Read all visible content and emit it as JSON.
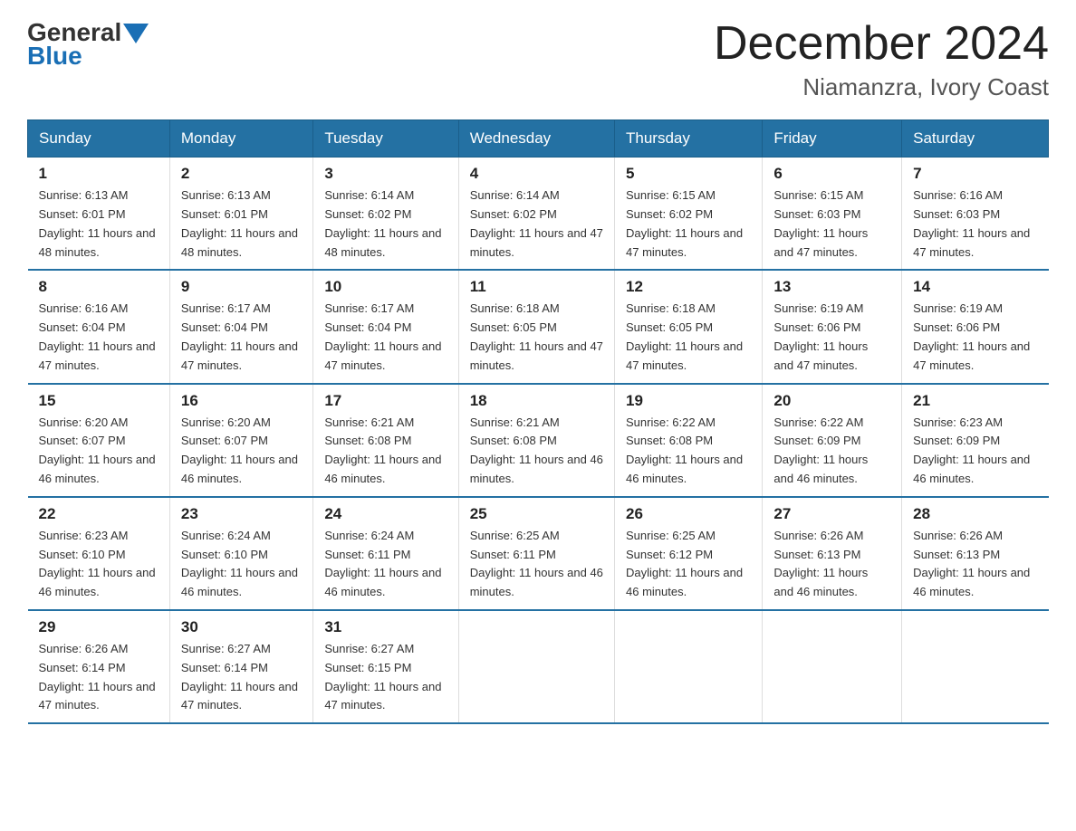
{
  "logo": {
    "text_general": "General",
    "text_blue": "Blue"
  },
  "title": "December 2024",
  "subtitle": "Niamanzra, Ivory Coast",
  "headers": [
    "Sunday",
    "Monday",
    "Tuesday",
    "Wednesday",
    "Thursday",
    "Friday",
    "Saturday"
  ],
  "weeks": [
    [
      {
        "day": "1",
        "sunrise": "6:13 AM",
        "sunset": "6:01 PM",
        "daylight": "11 hours and 48 minutes."
      },
      {
        "day": "2",
        "sunrise": "6:13 AM",
        "sunset": "6:01 PM",
        "daylight": "11 hours and 48 minutes."
      },
      {
        "day": "3",
        "sunrise": "6:14 AM",
        "sunset": "6:02 PM",
        "daylight": "11 hours and 48 minutes."
      },
      {
        "day": "4",
        "sunrise": "6:14 AM",
        "sunset": "6:02 PM",
        "daylight": "11 hours and 47 minutes."
      },
      {
        "day": "5",
        "sunrise": "6:15 AM",
        "sunset": "6:02 PM",
        "daylight": "11 hours and 47 minutes."
      },
      {
        "day": "6",
        "sunrise": "6:15 AM",
        "sunset": "6:03 PM",
        "daylight": "11 hours and 47 minutes."
      },
      {
        "day": "7",
        "sunrise": "6:16 AM",
        "sunset": "6:03 PM",
        "daylight": "11 hours and 47 minutes."
      }
    ],
    [
      {
        "day": "8",
        "sunrise": "6:16 AM",
        "sunset": "6:04 PM",
        "daylight": "11 hours and 47 minutes."
      },
      {
        "day": "9",
        "sunrise": "6:17 AM",
        "sunset": "6:04 PM",
        "daylight": "11 hours and 47 minutes."
      },
      {
        "day": "10",
        "sunrise": "6:17 AM",
        "sunset": "6:04 PM",
        "daylight": "11 hours and 47 minutes."
      },
      {
        "day": "11",
        "sunrise": "6:18 AM",
        "sunset": "6:05 PM",
        "daylight": "11 hours and 47 minutes."
      },
      {
        "day": "12",
        "sunrise": "6:18 AM",
        "sunset": "6:05 PM",
        "daylight": "11 hours and 47 minutes."
      },
      {
        "day": "13",
        "sunrise": "6:19 AM",
        "sunset": "6:06 PM",
        "daylight": "11 hours and 47 minutes."
      },
      {
        "day": "14",
        "sunrise": "6:19 AM",
        "sunset": "6:06 PM",
        "daylight": "11 hours and 47 minutes."
      }
    ],
    [
      {
        "day": "15",
        "sunrise": "6:20 AM",
        "sunset": "6:07 PM",
        "daylight": "11 hours and 46 minutes."
      },
      {
        "day": "16",
        "sunrise": "6:20 AM",
        "sunset": "6:07 PM",
        "daylight": "11 hours and 46 minutes."
      },
      {
        "day": "17",
        "sunrise": "6:21 AM",
        "sunset": "6:08 PM",
        "daylight": "11 hours and 46 minutes."
      },
      {
        "day": "18",
        "sunrise": "6:21 AM",
        "sunset": "6:08 PM",
        "daylight": "11 hours and 46 minutes."
      },
      {
        "day": "19",
        "sunrise": "6:22 AM",
        "sunset": "6:08 PM",
        "daylight": "11 hours and 46 minutes."
      },
      {
        "day": "20",
        "sunrise": "6:22 AM",
        "sunset": "6:09 PM",
        "daylight": "11 hours and 46 minutes."
      },
      {
        "day": "21",
        "sunrise": "6:23 AM",
        "sunset": "6:09 PM",
        "daylight": "11 hours and 46 minutes."
      }
    ],
    [
      {
        "day": "22",
        "sunrise": "6:23 AM",
        "sunset": "6:10 PM",
        "daylight": "11 hours and 46 minutes."
      },
      {
        "day": "23",
        "sunrise": "6:24 AM",
        "sunset": "6:10 PM",
        "daylight": "11 hours and 46 minutes."
      },
      {
        "day": "24",
        "sunrise": "6:24 AM",
        "sunset": "6:11 PM",
        "daylight": "11 hours and 46 minutes."
      },
      {
        "day": "25",
        "sunrise": "6:25 AM",
        "sunset": "6:11 PM",
        "daylight": "11 hours and 46 minutes."
      },
      {
        "day": "26",
        "sunrise": "6:25 AM",
        "sunset": "6:12 PM",
        "daylight": "11 hours and 46 minutes."
      },
      {
        "day": "27",
        "sunrise": "6:26 AM",
        "sunset": "6:13 PM",
        "daylight": "11 hours and 46 minutes."
      },
      {
        "day": "28",
        "sunrise": "6:26 AM",
        "sunset": "6:13 PM",
        "daylight": "11 hours and 46 minutes."
      }
    ],
    [
      {
        "day": "29",
        "sunrise": "6:26 AM",
        "sunset": "6:14 PM",
        "daylight": "11 hours and 47 minutes."
      },
      {
        "day": "30",
        "sunrise": "6:27 AM",
        "sunset": "6:14 PM",
        "daylight": "11 hours and 47 minutes."
      },
      {
        "day": "31",
        "sunrise": "6:27 AM",
        "sunset": "6:15 PM",
        "daylight": "11 hours and 47 minutes."
      },
      {
        "day": "",
        "sunrise": "",
        "sunset": "",
        "daylight": ""
      },
      {
        "day": "",
        "sunrise": "",
        "sunset": "",
        "daylight": ""
      },
      {
        "day": "",
        "sunrise": "",
        "sunset": "",
        "daylight": ""
      },
      {
        "day": "",
        "sunrise": "",
        "sunset": "",
        "daylight": ""
      }
    ]
  ],
  "labels": {
    "sunrise": "Sunrise: ",
    "sunset": "Sunset: ",
    "daylight": "Daylight: "
  }
}
